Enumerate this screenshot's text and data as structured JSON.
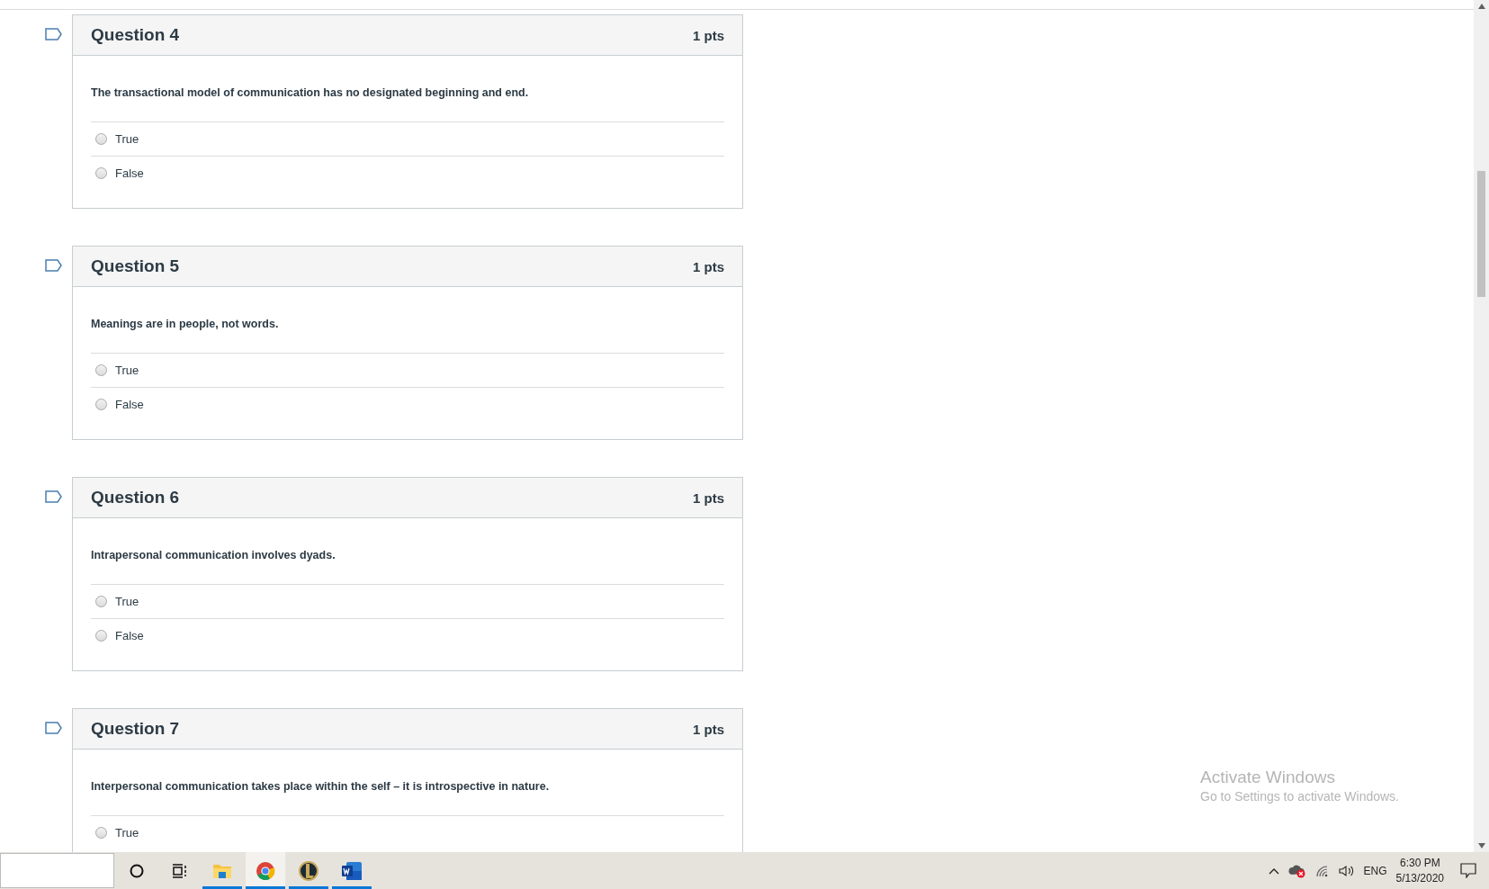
{
  "questions": [
    {
      "title": "Question 4",
      "points": "1 pts",
      "text": "The transactional model of communication has no designated beginning and end.",
      "options": [
        {
          "label": "True",
          "selected": false
        },
        {
          "label": "False",
          "selected": false
        }
      ]
    },
    {
      "title": "Question 5",
      "points": "1 pts",
      "text": "Meanings are in people, not words.",
      "options": [
        {
          "label": "True",
          "selected": false
        },
        {
          "label": "False",
          "selected": false
        }
      ]
    },
    {
      "title": "Question 6",
      "points": "1 pts",
      "text": "Intrapersonal communication involves dyads.",
      "options": [
        {
          "label": "True",
          "selected": false
        },
        {
          "label": "False",
          "selected": false
        }
      ]
    },
    {
      "title": "Question 7",
      "points": "1 pts",
      "text": "Interpersonal communication takes place within the self – it is introspective in nature.",
      "options": [
        {
          "label": "True",
          "selected": false
        }
      ]
    }
  ],
  "activation_notice": {
    "title": "Activate Windows",
    "subtitle": "Go to Settings to activate Windows."
  },
  "taskbar": {
    "apps": [
      {
        "kind": "explorer",
        "running": true,
        "selected": false
      },
      {
        "kind": "browser",
        "running": true,
        "selected": true
      },
      {
        "kind": "game",
        "running": true,
        "selected": false
      },
      {
        "kind": "word",
        "running": true,
        "selected": false
      }
    ],
    "language": "ENG",
    "time": "6:30 PM",
    "date": "5/13/2020"
  }
}
